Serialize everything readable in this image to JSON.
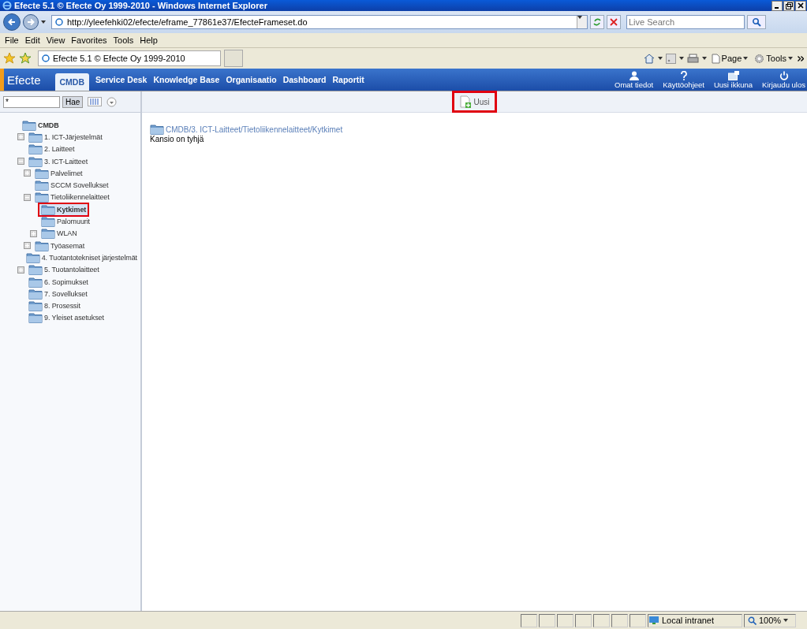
{
  "window": {
    "title": "Efecte 5.1 © Efecte Oy 1999-2010 - Windows Internet Explorer"
  },
  "address_bar": {
    "url": "http://yleefehki02/efecte/eframe_77861e37/EfecteFrameset.do",
    "search_placeholder": "Live Search"
  },
  "menu": [
    "File",
    "Edit",
    "View",
    "Favorites",
    "Tools",
    "Help"
  ],
  "browser_tab": {
    "title": "Efecte 5.1 © Efecte Oy 1999-2010"
  },
  "command_bar": [
    {
      "label": "Page"
    },
    {
      "label": "Tools"
    }
  ],
  "app_nav": {
    "logo": "Efecte",
    "tabs": [
      {
        "label": "CMDB",
        "selected": true
      },
      {
        "label": "Service Desk",
        "selected": false
      },
      {
        "label": "Knowledge Base",
        "selected": false
      },
      {
        "label": "Organisaatio",
        "selected": false
      },
      {
        "label": "Dashboard",
        "selected": false
      },
      {
        "label": "Raportit",
        "selected": false
      }
    ],
    "actions": [
      {
        "kind": "user",
        "label": "Omat tiedot"
      },
      {
        "kind": "help",
        "label": "Käyttöohjeet"
      },
      {
        "kind": "window",
        "label": "Uusi ikkuna"
      },
      {
        "kind": "power",
        "label": "Kirjaudu ulos"
      }
    ]
  },
  "sidebar": {
    "search": {
      "value": "*",
      "button": "Hae"
    },
    "tree": [
      {
        "label": "CMDB",
        "selected": false,
        "highlighted": false,
        "children": [
          {
            "label": "1. ICT-Järjestelmät",
            "selected": false,
            "highlighted": false,
            "expanded": false
          },
          {
            "label": "2. Laitteet",
            "selected": false,
            "highlighted": false
          },
          {
            "label": "3. ICT-Laitteet",
            "selected": false,
            "highlighted": false,
            "expanded": true,
            "children": [
              {
                "label": "Palvelimet",
                "selected": false,
                "highlighted": false,
                "expanded": false
              },
              {
                "label": "SCCM Sovellukset",
                "selected": false,
                "highlighted": false
              },
              {
                "label": "Tietoliikennelaitteet",
                "selected": false,
                "highlighted": false,
                "expanded": true,
                "children": [
                  {
                    "label": "Kytkimet",
                    "selected": true,
                    "highlighted": true
                  },
                  {
                    "label": "Palomuurit",
                    "selected": false,
                    "highlighted": false
                  },
                  {
                    "label": "WLAN",
                    "selected": false,
                    "highlighted": false,
                    "expanded": false
                  }
                ]
              },
              {
                "label": "Työasemat",
                "selected": false,
                "highlighted": false,
                "expanded": false
              }
            ]
          },
          {
            "label": "4. Tuotantotekniset järjestelmät",
            "selected": false,
            "highlighted": false
          },
          {
            "label": "5. Tuotantolaitteet",
            "selected": false,
            "highlighted": false,
            "expanded": false
          },
          {
            "label": "6. Sopimukset",
            "selected": false,
            "highlighted": false
          },
          {
            "label": "7. Sovellukset",
            "selected": false,
            "highlighted": false
          },
          {
            "label": "8. Prosessit",
            "selected": false,
            "highlighted": false
          },
          {
            "label": "9. Yleiset asetukset",
            "selected": false,
            "highlighted": false
          }
        ]
      }
    ]
  },
  "toolbar": {
    "new_button": {
      "label": "Uusi",
      "highlighted": true
    }
  },
  "content": {
    "breadcrumb": "CMDB/3. ICT-Laitteet/Tietoliikennelaitteet/Kytkimet",
    "message": "Kansio on tyhjä"
  },
  "status_bar": {
    "zone": "Local intranet",
    "zoom": "100%"
  }
}
